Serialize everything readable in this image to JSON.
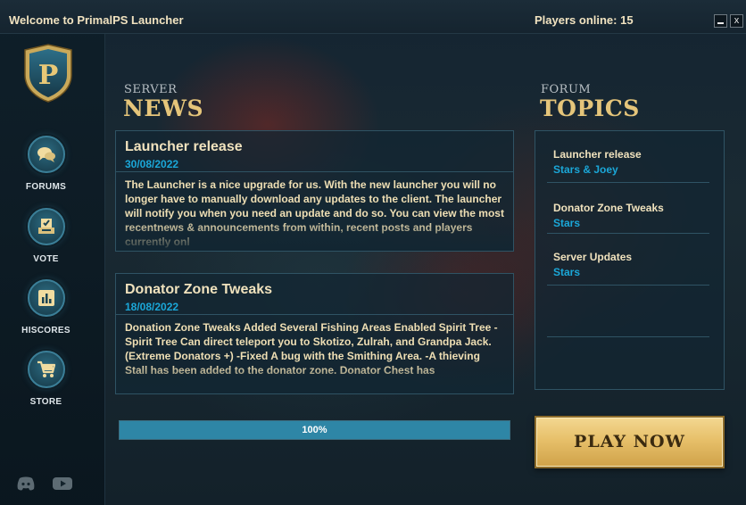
{
  "window": {
    "title": "Welcome to PrimalPS Launcher",
    "players_online": "Players online: 15",
    "close_glyph": "x"
  },
  "brand": {
    "logo_letter": "P"
  },
  "sidebar": {
    "items": [
      {
        "label": "FORUMS",
        "icon": "chat-bubbles-icon"
      },
      {
        "label": "VOTE",
        "icon": "vote-ballot-icon"
      },
      {
        "label": "HISCORES",
        "icon": "bar-chart-icon"
      },
      {
        "label": "STORE",
        "icon": "cart-icon"
      }
    ],
    "social": [
      {
        "icon": "discord-icon"
      },
      {
        "icon": "youtube-icon"
      }
    ]
  },
  "news": {
    "kicker": "SERVER",
    "heading": "NEWS",
    "posts": [
      {
        "title": "Launcher release",
        "date": "30/08/2022",
        "body": "The Launcher is a nice upgrade for us. With the new launcher you will no longer have to manually download any updates to the client. The launcher will notify you when you need an update and do so. You can view the most recentnews & announcements from within, recent posts and players currently onl"
      },
      {
        "title": "Donator Zone Tweaks",
        "date": "18/08/2022",
        "body": "Donation Zone Tweaks Added Several Fishing Areas Enabled Spirit Tree -Spirit Tree Can direct teleport you to Skotizo, Zulrah, and Grandpa Jack. (Extreme Donators +) -Fixed A bug with the Smithing Area. -A thieving Stall has been added to the donator zone. Donator Chest has"
      }
    ]
  },
  "forum": {
    "kicker": "FORUM",
    "heading": "TOPICS",
    "topics": [
      {
        "title": "Launcher release",
        "author": "Stars & Joey"
      },
      {
        "title": "Donator Zone Tweaks",
        "author": "Stars"
      },
      {
        "title": "Server Updates",
        "author": "Stars"
      }
    ]
  },
  "progress": {
    "value": 1.0,
    "label": "100%"
  },
  "play_button": {
    "label": "PLAY NOW"
  },
  "colors": {
    "accent_gold": "#e5c57a",
    "date_blue": "#1ba7d8",
    "progress_fill": "#2e86a6",
    "play_gold": "#e7c06a"
  }
}
